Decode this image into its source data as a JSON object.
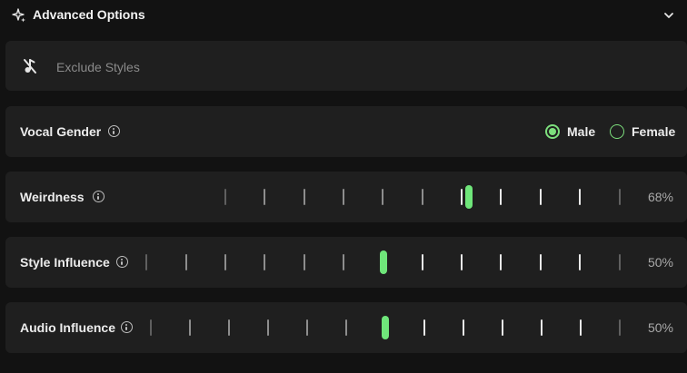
{
  "header": {
    "title": "Advanced Options",
    "icon": "sparkles-icon",
    "toggle_icon": "chevron-down-icon"
  },
  "exclude": {
    "placeholder": "Exclude Styles",
    "icon": "music-note-off-icon"
  },
  "vocal_gender": {
    "label": "Vocal Gender",
    "options": [
      {
        "label": "Male",
        "selected": true
      },
      {
        "label": "Female",
        "selected": false
      }
    ]
  },
  "sliders": [
    {
      "label": "Weirdness",
      "value_text": "68%",
      "value": 68
    },
    {
      "label": "Style Influence",
      "value_text": "50%",
      "value": 50
    },
    {
      "label": "Audio Influence",
      "value_text": "50%",
      "value": 50
    }
  ],
  "colors": {
    "accent": "#6fe67a",
    "panel": "#1f1f1f",
    "background": "#121212"
  }
}
